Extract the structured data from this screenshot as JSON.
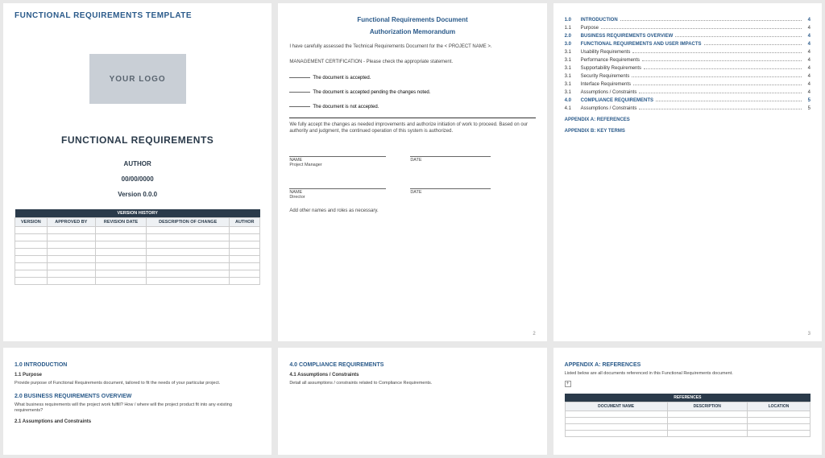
{
  "page1": {
    "header": "FUNCTIONAL REQUIREMENTS TEMPLATE",
    "logo": "YOUR LOGO",
    "title": "FUNCTIONAL REQUIREMENTS",
    "author": "AUTHOR",
    "date": "00/00/0000",
    "version": "Version 0.0.0",
    "vh_title": "VERSION HISTORY",
    "cols": [
      "VERSION",
      "APPROVED BY",
      "REVISION DATE",
      "DESCRIPTION OF CHANGE",
      "AUTHOR"
    ]
  },
  "page2": {
    "title1": "Functional Requirements Document",
    "title2": "Authorization Memorandum",
    "intro": "I have carefully assessed the Technical Requirements Document for the < PROJECT NAME >.",
    "cert": "MANAGEMENT CERTIFICATION - Please check the appropriate statement.",
    "chk1": "The document is accepted.",
    "chk2": "The document is accepted pending the changes noted.",
    "chk3": "The document is not accepted.",
    "accept": "We fully accept the changes as needed improvements and authorize initiation of work to proceed. Based on our authority and judgment, the continued operation of this system is authorized.",
    "name": "NAME",
    "date": "DATE",
    "role1": "Project Manager",
    "role2": "Director",
    "note": "Add other names and roles as necessary."
  },
  "toc": [
    {
      "n": "1.0",
      "t": "INTRODUCTION",
      "p": "4",
      "b": true
    },
    {
      "n": "1.1",
      "t": "Purpose",
      "p": "4",
      "b": false
    },
    {
      "n": "2.0",
      "t": "BUSINESS REQUIREMENTS OVERVIEW",
      "p": "4",
      "b": true
    },
    {
      "n": "3.0",
      "t": "FUNCTIONAL REQUIREMENTS AND USER IMPACTS",
      "p": "4",
      "b": true
    },
    {
      "n": "3.1",
      "t": "Usability Requirements",
      "p": "4",
      "b": false
    },
    {
      "n": "3.1",
      "t": "Performance Requirements",
      "p": "4",
      "b": false
    },
    {
      "n": "3.1",
      "t": "Supportability Requirements",
      "p": "4",
      "b": false
    },
    {
      "n": "3.1",
      "t": "Security Requirements",
      "p": "4",
      "b": false
    },
    {
      "n": "3.1",
      "t": "Interface Requirements",
      "p": "4",
      "b": false
    },
    {
      "n": "3.1",
      "t": "Assumptions / Constraints",
      "p": "4",
      "b": false
    },
    {
      "n": "4.0",
      "t": "COMPLIANCE REQUIREMENTS",
      "p": "5",
      "b": true
    },
    {
      "n": "4.1",
      "t": "Assumptions / Constraints",
      "p": "5",
      "b": false
    }
  ],
  "appendix_a": "APPENDIX A: REFERENCES",
  "appendix_b": "APPENDIX B: KEY TERMS",
  "page4": {
    "s1": "1.0  INTRODUCTION",
    "s11": "1.1    Purpose",
    "s11t": "Provide purpose of Functional Requirements document, tailored to fit the needs of your particular project.",
    "s2": "2.0  BUSINESS REQUIREMENTS OVERVIEW",
    "s2t": "What business requirements will the project work fulfill?  How / where will the project product fit into any existing requirements?",
    "s21": "2.1    Assumptions and Constraints"
  },
  "page5": {
    "s4": "4.0  COMPLIANCE REQUIREMENTS",
    "s41": "4.1    Assumptions / Constraints",
    "s41t": "Detail all assumptions / constraints related to Compliance Requirements."
  },
  "page6": {
    "h": "APPENDIX A: REFERENCES",
    "t": "Listed below are all documents referenced in this Functional Requirements document.",
    "th": "REFERENCES",
    "cols": [
      "DOCUMENT NAME",
      "DESCRIPTION",
      "LOCATION"
    ]
  },
  "pg2": "2",
  "pg3": "3"
}
